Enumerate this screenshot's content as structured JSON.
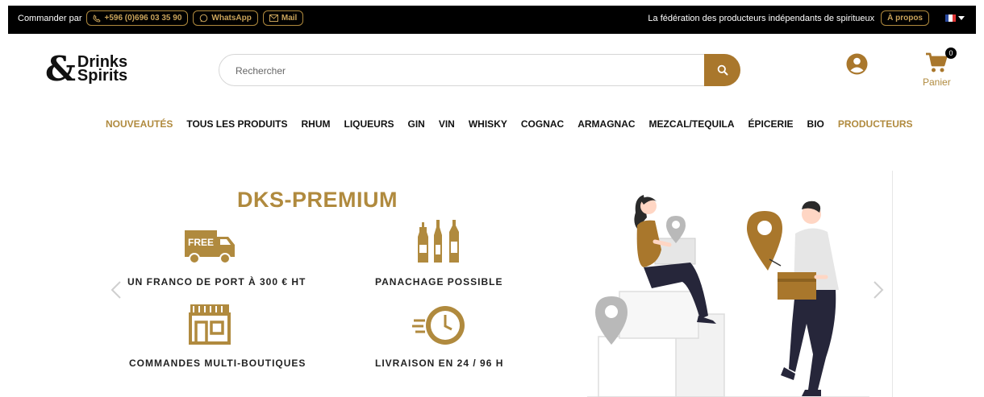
{
  "topbar": {
    "order_label": "Commander par",
    "phone": "+596 (0)696 03 35 90",
    "whatsapp": "WhatsApp",
    "mail": "Mail",
    "federation_text": "La fédération des producteurs indépendants de spiritueux",
    "about": "À propos"
  },
  "logo": {
    "amp": "&",
    "line1": "Drinks",
    "line2": "Spirits"
  },
  "search": {
    "placeholder": "Rechercher"
  },
  "cart": {
    "count": "0",
    "label": "Panier"
  },
  "nav": {
    "items": [
      "NOUVEAUTÉS",
      "TOUS LES PRODUITS",
      "RHUM",
      "LIQUEURS",
      "GIN",
      "VIN",
      "WHISKY",
      "COGNAC",
      "ARMAGNAC",
      "MEZCAL/TEQUILA",
      "ÉPICERIE",
      "BIO",
      "PRODUCTEURS"
    ]
  },
  "banner": {
    "title": "DKS-PREMIUM",
    "truck_text": "FREE",
    "features": [
      "UN FRANCO DE PORT À 300 € HT",
      "PANACHAGE POSSIBLE",
      "COMMANDES MULTI-BOUTIQUES",
      "LIVRAISON EN 24 / 96 H"
    ]
  },
  "colors": {
    "accent": "#b08a3e",
    "search_button": "#a9772c",
    "topbar": "#000000"
  }
}
